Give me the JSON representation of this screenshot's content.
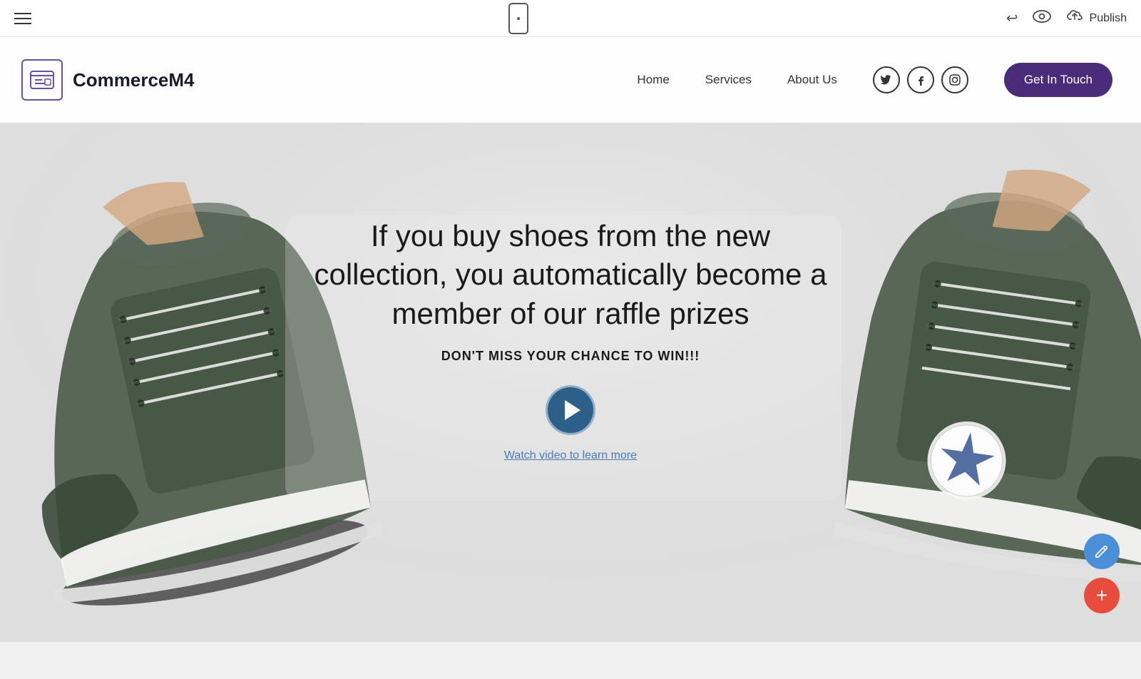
{
  "editor": {
    "toolbar": {
      "publish_label": "Publish",
      "hamburger_label": "Menu"
    }
  },
  "site": {
    "logo": {
      "text": "CommerceM4"
    },
    "nav": {
      "links": [
        {
          "label": "Home",
          "href": "#"
        },
        {
          "label": "Services",
          "href": "#"
        },
        {
          "label": "About Us",
          "href": "#"
        }
      ]
    },
    "cta": {
      "label": "Get In Touch"
    },
    "social": {
      "twitter": "𝕏",
      "facebook": "f",
      "instagram": "◻"
    },
    "hero": {
      "headline": "If you buy shoes from the new collection, you automatically become a member of our raffle prizes",
      "subtext": "DON'T MISS YOUR CHANCE TO WIN!!!",
      "video_label": "Watch video to learn more"
    }
  }
}
